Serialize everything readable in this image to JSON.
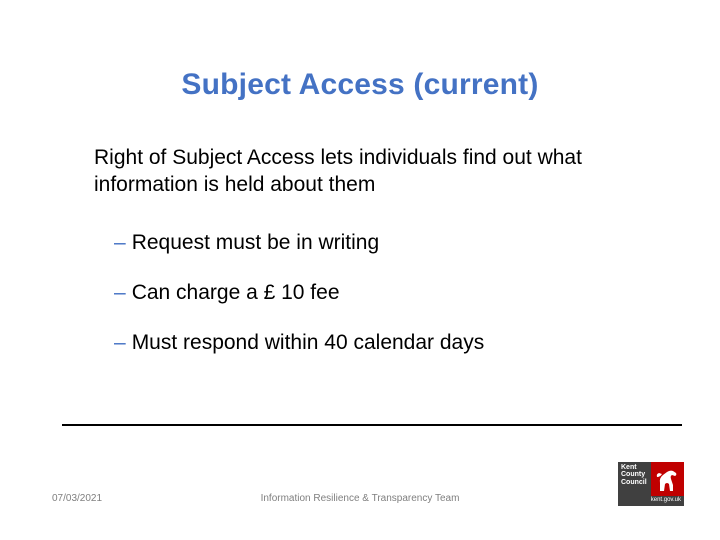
{
  "title": "Subject Access (current)",
  "intro": "Right of Subject Access lets individuals find out what information is held about them",
  "bullets": [
    "Request must be in writing",
    "Can charge a £ 10 fee",
    "Must respond within 40 calendar days"
  ],
  "date": "07/03/2021",
  "footer": "Information Resilience & Transparency Team",
  "logo": {
    "line1": "Kent",
    "line2": "County",
    "line3": "Council",
    "url": "kent.gov.uk"
  }
}
